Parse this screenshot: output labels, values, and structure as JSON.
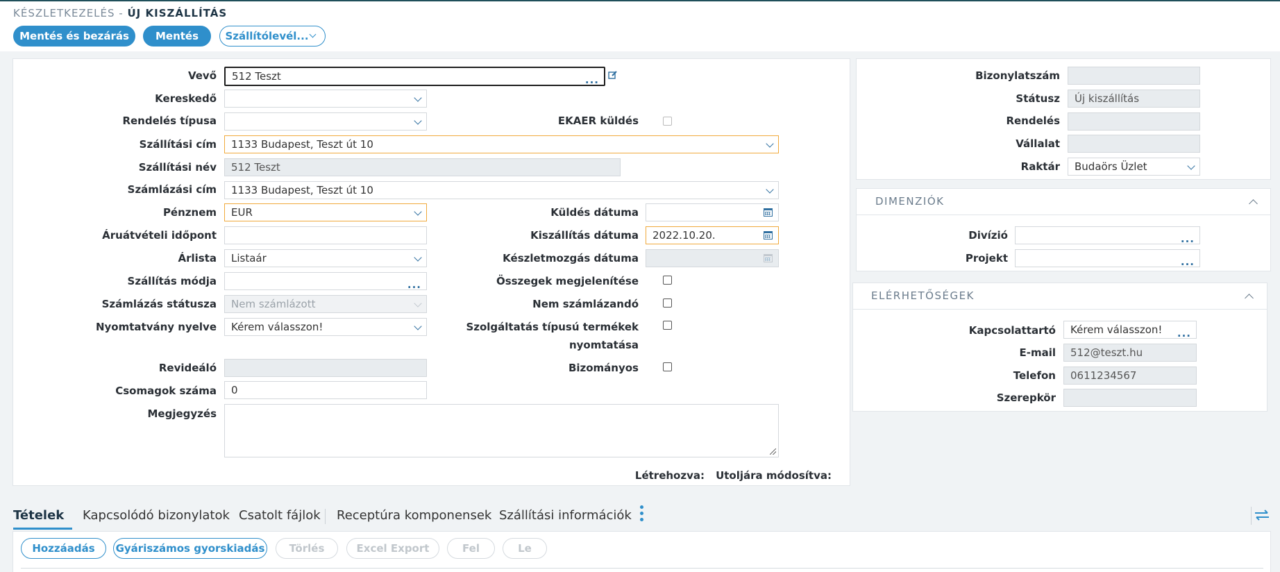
{
  "breadcrumb": {
    "root": "KÉSZLETKEZELÉS -",
    "current": "ÚJ KISZÁLLÍTÁS"
  },
  "toolbar": {
    "save_close": "Mentés és bezárás",
    "save": "Mentés",
    "delivery_note": "Szállítólevél..."
  },
  "form": {
    "vevo": {
      "label": "Vevő",
      "value": "512 Teszt"
    },
    "kereskedo": {
      "label": "Kereskedő",
      "value": ""
    },
    "rendeles_tipusa": {
      "label": "Rendelés típusa",
      "value": ""
    },
    "ekaer": {
      "label": "EKAER küldés"
    },
    "szallitasi_cim": {
      "label": "Szállítási cím",
      "value": "1133 Budapest, Teszt út 10"
    },
    "szallitasi_nev": {
      "label": "Szállítási név",
      "value": "512 Teszt"
    },
    "szamlazasi_cim": {
      "label": "Számlázási cím",
      "value": "1133 Budapest, Teszt út 10"
    },
    "penznem": {
      "label": "Pénznem",
      "value": "EUR"
    },
    "kuldes_datuma": {
      "label": "Küldés dátuma",
      "value": ""
    },
    "aruatveteli": {
      "label": "Áruátvételi időpont",
      "value": ""
    },
    "kiszallitas_datuma": {
      "label": "Kiszállítás dátuma",
      "value": "2022.10.20."
    },
    "arlista": {
      "label": "Árlista",
      "value": "Listaár"
    },
    "keszletmozgas": {
      "label": "Készletmozgás dátuma",
      "value": ""
    },
    "szallitas_modja": {
      "label": "Szállítás módja",
      "value": ""
    },
    "osszegek": {
      "label": "Összegek megjelenítése"
    },
    "szamlazas_statusza": {
      "label": "Számlázás státusza",
      "value": "Nem számlázott"
    },
    "nem_szamlazando": {
      "label": "Nem számlázandó"
    },
    "nyomtatvany_nyelve": {
      "label": "Nyomtatvány nyelve",
      "value": "Kérem válasszon!"
    },
    "szolgaltatas": {
      "label_1": "Szolgáltatás típusú termékek",
      "label_2": "nyomtatása"
    },
    "revidealo": {
      "label": "Revideáló",
      "value": ""
    },
    "bizomanyos": {
      "label": "Bizományos"
    },
    "csomagok": {
      "label": "Csomagok száma",
      "value": "0"
    },
    "megjegyzes": {
      "label": "Megjegyzés",
      "value": ""
    },
    "letrehozva": "Létrehozva:",
    "utoljara": "Utoljára módosítva:"
  },
  "side": {
    "bizonylatszam": {
      "label": "Bizonylatszám",
      "value": ""
    },
    "statusz": {
      "label": "Státusz",
      "value": "Új kiszállítás"
    },
    "rendeles": {
      "label": "Rendelés",
      "value": ""
    },
    "vallalat": {
      "label": "Vállalat",
      "value": ""
    },
    "raktar": {
      "label": "Raktár",
      "value": "Budaörs Üzlet"
    }
  },
  "dimensions": {
    "title": "DIMENZIÓK",
    "divizio": {
      "label": "Divízió",
      "value": ""
    },
    "projekt": {
      "label": "Projekt",
      "value": ""
    }
  },
  "contacts": {
    "title": "ELÉRHETŐSÉGEK",
    "kapcsolattarto": {
      "label": "Kapcsolattartó",
      "value": "Kérem válasszon!"
    },
    "email": {
      "label": "E-mail",
      "value": "512@teszt.hu"
    },
    "telefon": {
      "label": "Telefon",
      "value": "0611234567"
    },
    "szerepkor": {
      "label": "Szerepkör",
      "value": ""
    }
  },
  "tabs": [
    "Tételek",
    "Kapcsolódó bizonylatok",
    "Csatolt fájlok",
    "Receptúra komponensek",
    "Szállítási információk"
  ],
  "items_toolbar": {
    "add": "Hozzáadás",
    "serial_quick": "Gyáriszámos gyorskiadás",
    "delete": "Törlés",
    "excel": "Excel Export",
    "up": "Fel",
    "down": "Le"
  },
  "colors": {
    "accent": "#2f8fcb",
    "highlight": "#f0a93b"
  }
}
